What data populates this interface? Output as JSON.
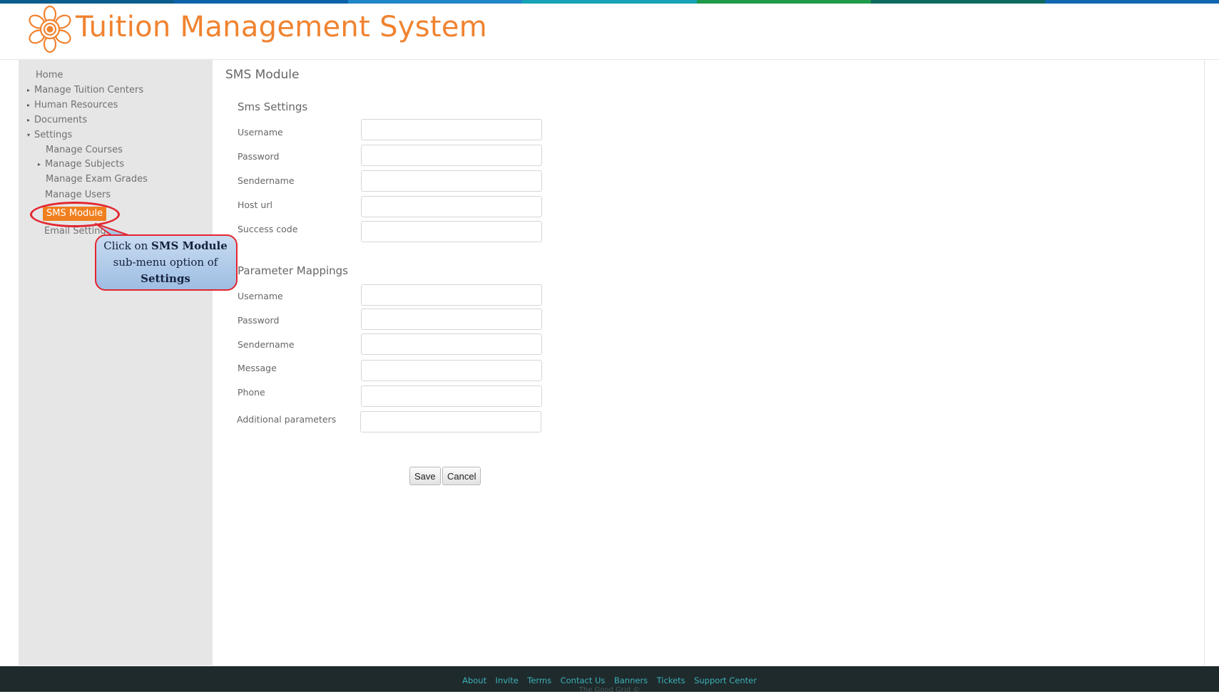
{
  "header": {
    "title": "Tuition Management System",
    "topbar_colors": [
      "#0a5c8c",
      "#0d63aa",
      "#1f86c7",
      "#17a2b8",
      "#1e9a4a",
      "#0f6a5e",
      "#1067b0"
    ]
  },
  "sidebar": {
    "items": [
      {
        "label": "Home",
        "has_arrow": false
      },
      {
        "label": "Manage Tuition Centers",
        "has_arrow": true,
        "arrow": "▸"
      },
      {
        "label": "Human Resources",
        "has_arrow": true,
        "arrow": "▸"
      },
      {
        "label": "Documents",
        "has_arrow": true,
        "arrow": "▸"
      },
      {
        "label": "Settings",
        "has_arrow": true,
        "arrow": "▾",
        "expanded": true
      }
    ],
    "settings_children": [
      {
        "label": "Manage Courses",
        "has_arrow": false
      },
      {
        "label": "Manage Subjects",
        "has_arrow": true,
        "arrow": "▸"
      },
      {
        "label": "Manage Exam Grades",
        "has_arrow": false
      },
      {
        "label": "Manage Users",
        "has_arrow": false
      },
      {
        "label": "SMS Module",
        "active": true
      },
      {
        "label": "Email Settings",
        "has_arrow": false
      }
    ]
  },
  "callout": {
    "line1_prefix": "Click on ",
    "line1_bold": "SMS Module",
    "line2": "sub-menu option of",
    "line3_bold": "Settings",
    "highlight_color": "#e3262f"
  },
  "main": {
    "page_title": "SMS Module",
    "sms_settings": {
      "title": "Sms Settings",
      "fields": [
        {
          "label": "Username",
          "value": ""
        },
        {
          "label": "Password",
          "value": ""
        },
        {
          "label": "Sendername",
          "value": ""
        },
        {
          "label": "Host url",
          "value": ""
        },
        {
          "label": "Success code",
          "value": ""
        }
      ]
    },
    "parameter_mappings": {
      "title": "Parameter Mappings",
      "fields": [
        {
          "label": "Username",
          "value": ""
        },
        {
          "label": "Password",
          "value": ""
        },
        {
          "label": "Sendername",
          "value": ""
        },
        {
          "label": "Message",
          "value": ""
        },
        {
          "label": "Phone",
          "value": ""
        },
        {
          "label": "Additional parameters",
          "value": ""
        }
      ]
    },
    "buttons": {
      "save": "Save",
      "cancel": "Cancel"
    }
  },
  "footer": {
    "links": [
      "About",
      "Invite",
      "Terms",
      "Contact Us",
      "Banners",
      "Tickets",
      "Support Center"
    ],
    "copyright": "The Good Grid ©"
  },
  "colors": {
    "brand_orange": "#f08330",
    "active_menu": "#f07f1f",
    "footer_bg": "#1f2a2c",
    "footer_link": "#3ab1b8",
    "sidebar_bg": "#e6e6e6"
  }
}
